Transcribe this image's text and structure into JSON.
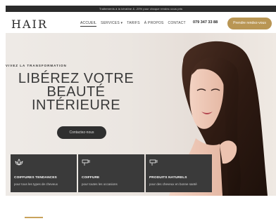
{
  "topbar": {
    "text": "Traitements à la kératine & -20% pour chaque rendez-vous pris"
  },
  "header": {
    "logo": "HAIR",
    "nav": [
      {
        "label": "ACCUEIL",
        "active": true
      },
      {
        "label": "SERVICES",
        "active": false
      },
      {
        "label": "TARIFS",
        "active": false
      },
      {
        "label": "À PROPOS",
        "active": false
      },
      {
        "label": "CONTACT",
        "active": false
      }
    ],
    "services_chevron": "▾",
    "phone": "079 347 33 88",
    "cta": "Prendre rendez-vous"
  },
  "hero": {
    "tagline": "VIVEZ LA TRANSFORMATION",
    "headline_1": "LIBÉREZ VOTRE",
    "headline_2": "BEAUTÉ",
    "headline_3": "INTÉRIEURE",
    "button": "Contactez-nous"
  },
  "features": [
    {
      "icon": "lotus-icon",
      "title": "COIFFURES TENDANCES",
      "subtitle": "pour tous les types de cheveux"
    },
    {
      "icon": "hair-dryer-icon",
      "title": "COIFFURE",
      "subtitle": "pour toutes les occasions"
    },
    {
      "icon": "hair-dryer-icon",
      "title": "PRODUITS NATURELS",
      "subtitle": "pour des cheveux en bonne santé"
    }
  ],
  "colors": {
    "accent": "#b99654",
    "dark": "#2b2b2b",
    "feature_bg": "#3a3a3a"
  }
}
